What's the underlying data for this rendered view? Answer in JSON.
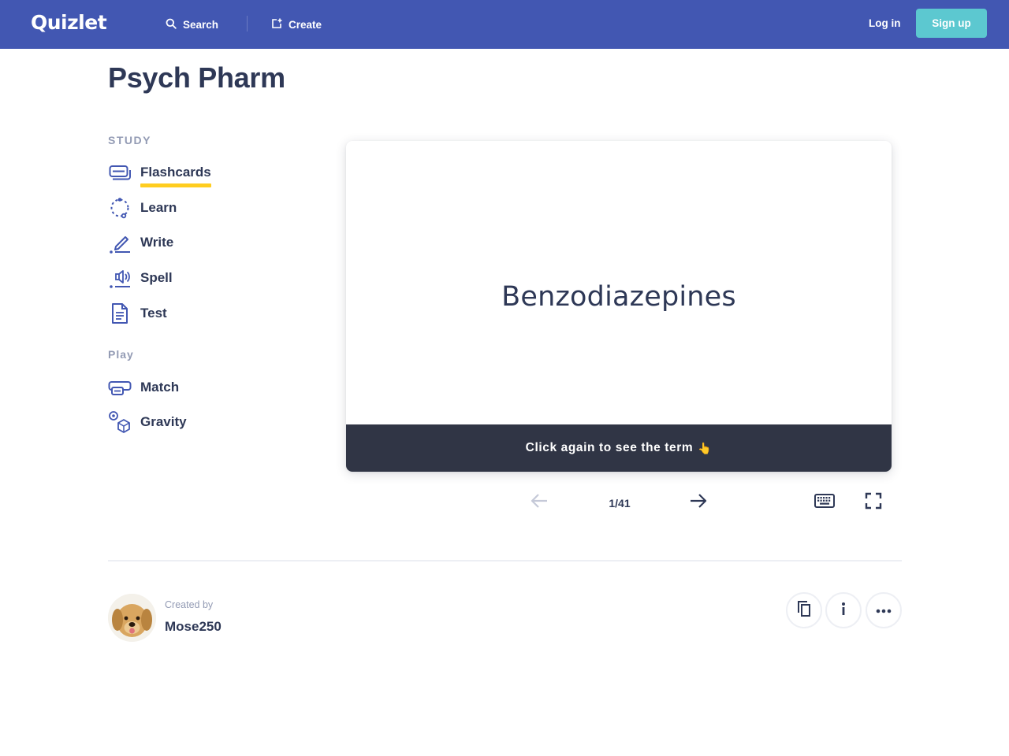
{
  "header": {
    "logo": "Quizlet",
    "search_label": "Search",
    "create_label": "Create",
    "login_label": "Log in",
    "signup_label": "Sign up"
  },
  "set": {
    "title": "Psych Pharm"
  },
  "sidebar": {
    "study_heading": "STUDY",
    "play_heading": "Play",
    "study_modes": [
      {
        "label": "Flashcards",
        "icon": "flashcards-icon",
        "active": true
      },
      {
        "label": "Learn",
        "icon": "learn-icon"
      },
      {
        "label": "Write",
        "icon": "write-icon"
      },
      {
        "label": "Spell",
        "icon": "spell-icon"
      },
      {
        "label": "Test",
        "icon": "test-icon"
      }
    ],
    "play_modes": [
      {
        "label": "Match",
        "icon": "match-icon"
      },
      {
        "label": "Gravity",
        "icon": "gravity-icon"
      }
    ]
  },
  "flashcard": {
    "text": "Benzodiazepines",
    "hint": "Click again to see the term",
    "hint_emoji": "👆",
    "counter": "1/41"
  },
  "controls": {
    "prev_icon": "arrow-left-icon",
    "next_icon": "arrow-right-icon",
    "keyboard_icon": "keyboard-icon",
    "fullscreen_icon": "fullscreen-icon"
  },
  "creator": {
    "created_by_label": "Created by",
    "username": "Mose250"
  },
  "actions": {
    "copy_icon": "copy-icon",
    "info_icon": "info-icon",
    "more_icon": "more-icon"
  },
  "colors": {
    "header_bg": "#4257b2",
    "signup_bg": "#5cc8d0",
    "active_underline": "#ffcd1f",
    "card_footer_bg": "#303545",
    "icon_blue": "#4257b2"
  }
}
